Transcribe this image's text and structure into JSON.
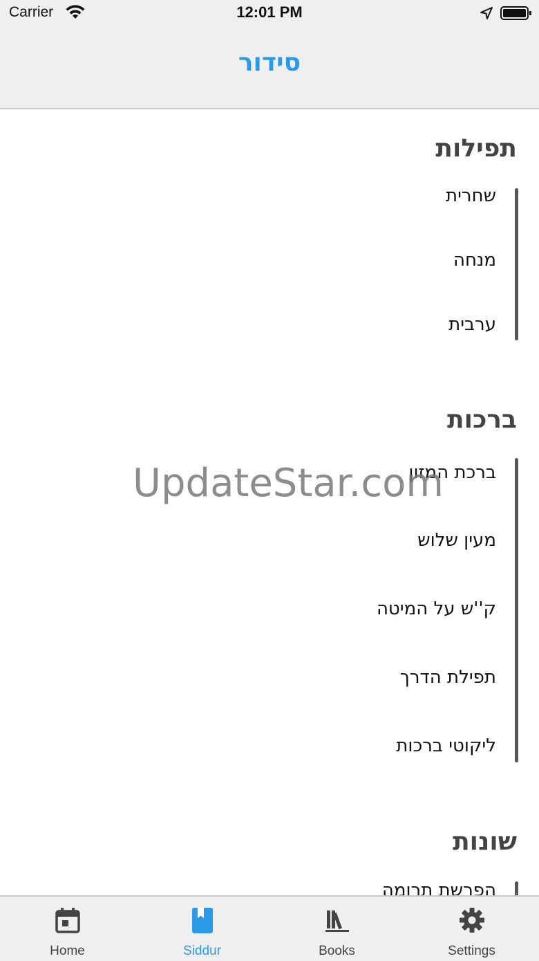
{
  "status_bar": {
    "carrier": "Carrier",
    "time": "12:01 PM"
  },
  "nav": {
    "title": "סידור"
  },
  "sections": [
    {
      "title": "תפילות",
      "items": [
        "שחרית",
        "מנחה",
        "ערבית"
      ]
    },
    {
      "title": "ברכות",
      "items": [
        "ברכת המזון",
        "מעין שלוש",
        "ק''ש על המיטה",
        "תפילת הדרך",
        "ליקוטי ברכות"
      ]
    },
    {
      "title": "שונות",
      "items": [
        "הפרשת תרומה"
      ]
    }
  ],
  "watermark": "UpdateStar.com",
  "tabs": [
    {
      "label": "Home",
      "icon": "calendar-icon"
    },
    {
      "label": "Siddur",
      "icon": "book-icon",
      "active": true
    },
    {
      "label": "Books",
      "icon": "library-icon"
    },
    {
      "label": "Settings",
      "icon": "gear-icon"
    }
  ],
  "colors": {
    "accent": "#2b9be8",
    "bar": "#555555",
    "chrome": "#efefef"
  }
}
